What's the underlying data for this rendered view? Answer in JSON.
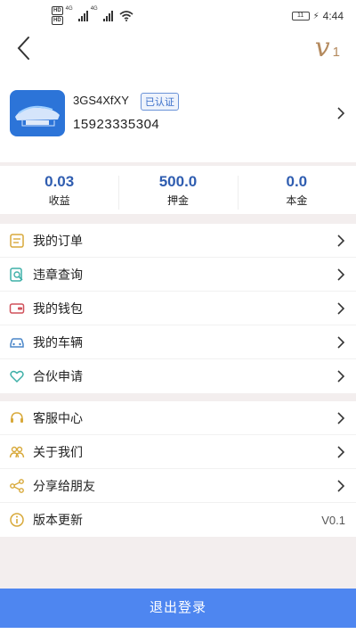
{
  "status_bar": {
    "hd_top": "HD",
    "hd_bottom": "HD",
    "network": "4G",
    "battery": "11",
    "time": "4:44"
  },
  "nav": {
    "vip_level": "1"
  },
  "profile": {
    "user_id": "3GS4XfXY",
    "verified_badge": "已认证",
    "phone": "15923335304"
  },
  "stats": [
    {
      "value": "0.03",
      "label": "收益"
    },
    {
      "value": "500.0",
      "label": "押金"
    },
    {
      "value": "0.0",
      "label": "本金"
    }
  ],
  "menu_group_1": [
    {
      "label": "我的订单",
      "icon": "order-list-icon"
    },
    {
      "label": "违章查询",
      "icon": "violation-search-icon"
    },
    {
      "label": "我的钱包",
      "icon": "wallet-icon"
    },
    {
      "label": "我的车辆",
      "icon": "car-icon"
    },
    {
      "label": "合伙申请",
      "icon": "partner-heart-icon"
    }
  ],
  "menu_group_2": [
    {
      "label": "客服中心",
      "icon": "customer-service-icon"
    },
    {
      "label": "关于我们",
      "icon": "about-us-icon"
    },
    {
      "label": "分享给朋友",
      "icon": "share-icon"
    },
    {
      "label": "版本更新",
      "icon": "info-icon",
      "value": "V0.1"
    }
  ],
  "logout_label": "退出登录",
  "colors": {
    "accent": "#4e86f0",
    "stat_value": "#2f5db0",
    "vip_gold": "#b48a5e",
    "icon_yellow": "#d8a93a",
    "icon_teal": "#3fb0a8",
    "icon_red": "#d0505a",
    "icon_blue": "#4a86c8",
    "page_bg": "#f3eeee"
  }
}
